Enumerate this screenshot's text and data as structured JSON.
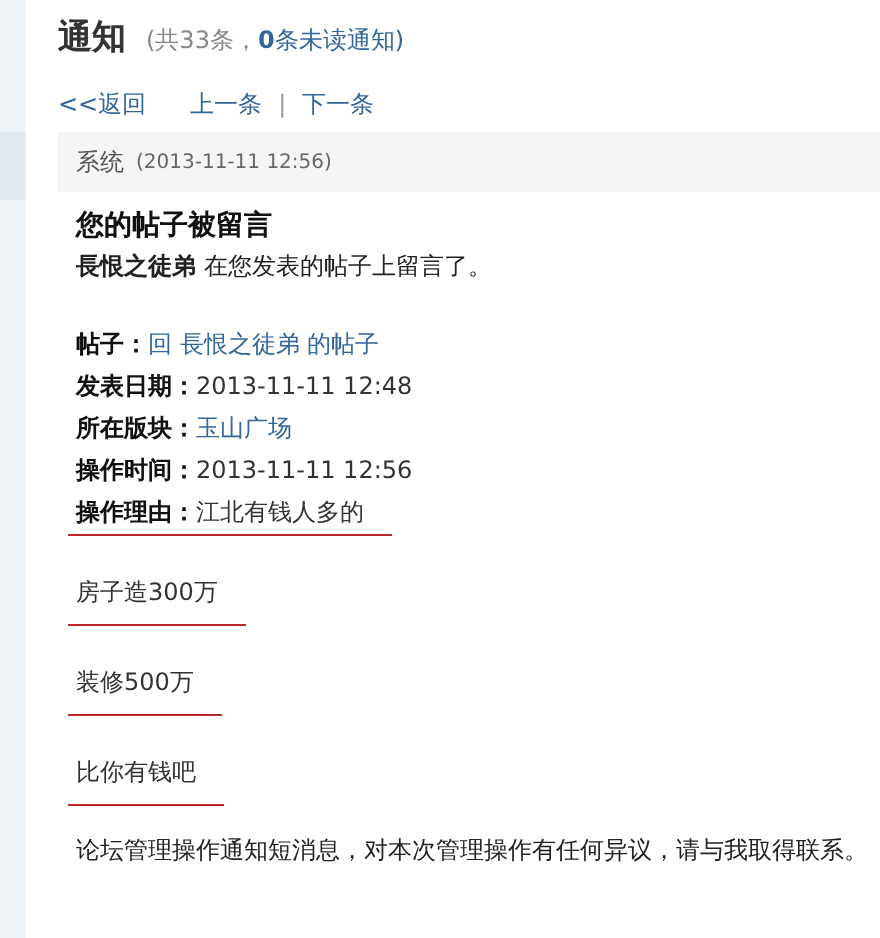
{
  "header": {
    "title": "通知",
    "count_open": "(共33条，",
    "unread": "0",
    "count_close": "条未读通知)"
  },
  "nav": {
    "back": "<<返回",
    "prev": "上一条",
    "separator": "|",
    "next": "下一条"
  },
  "message": {
    "sender": "系统",
    "time": "(2013-11-11 12:56)",
    "subject": "您的帖子被留言",
    "summary": "**長恨之徒弟** 在您发表的帖子上留言了。",
    "fields": [
      {
        "label": "帖子：",
        "value": "回 長恨之徒弟 的帖子",
        "kind": "link",
        "underlined": false
      },
      {
        "label": "发表日期：",
        "value": "2013-11-11 12:48",
        "kind": "text",
        "underlined": false
      },
      {
        "label": "所在版块：",
        "value": "玉山广场",
        "kind": "link",
        "underlined": false
      },
      {
        "label": "操作时间：",
        "value": "2013-11-11 12:56",
        "kind": "text",
        "underlined": false
      },
      {
        "label": "操作理由：",
        "value": "江北有钱人多的",
        "kind": "text",
        "underlined": true
      }
    ],
    "lines": [
      {
        "text": "房子造300万",
        "underlined": true
      },
      {
        "text": "装修500万",
        "underlined": true
      },
      {
        "text": "比你有钱吧",
        "underlined": true
      }
    ],
    "footer": "论坛管理操作通知短消息，对本次管理操作有任何异议，请与我取得联系。"
  }
}
